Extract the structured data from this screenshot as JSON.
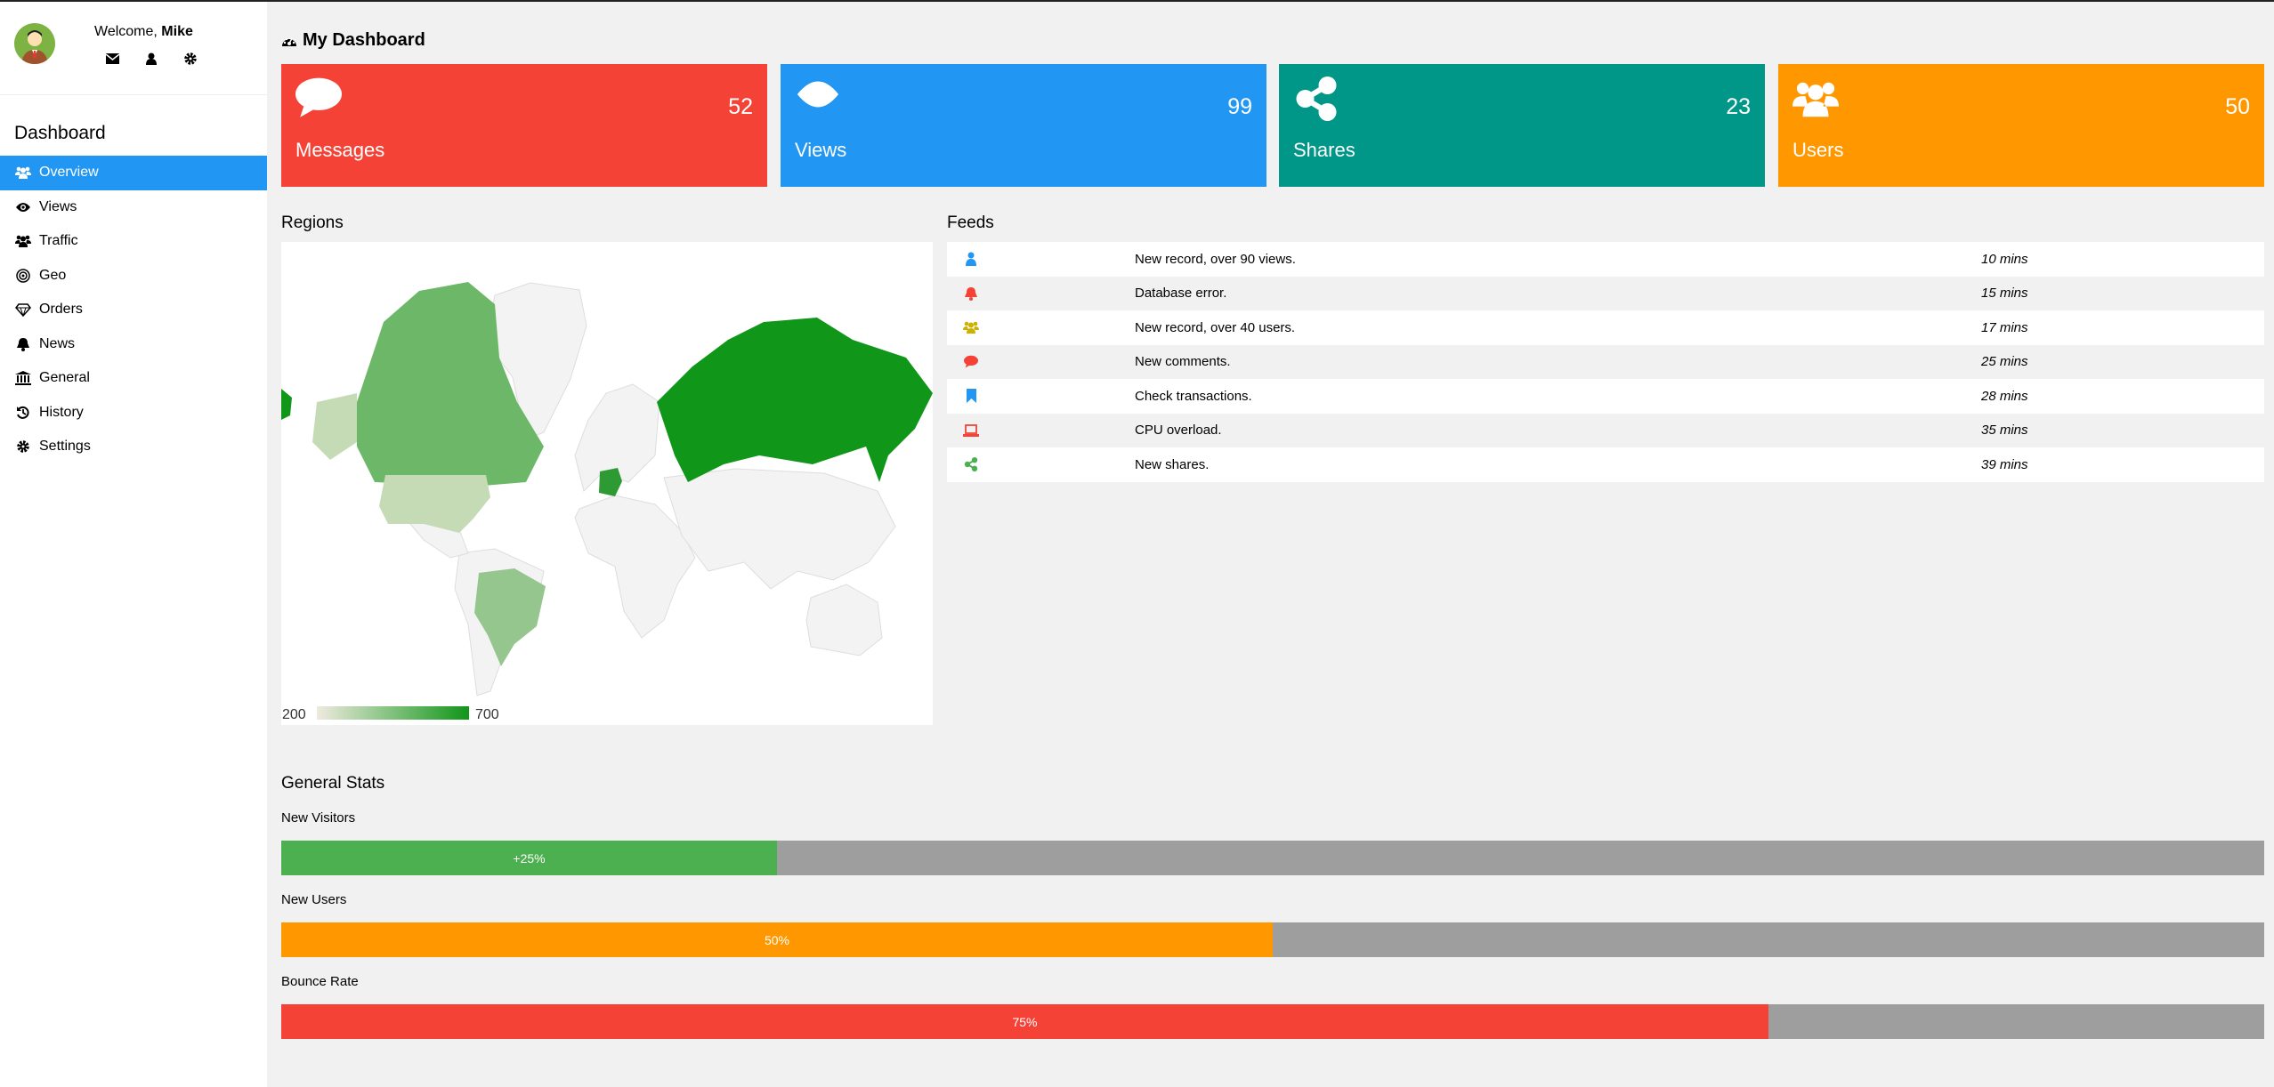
{
  "user": {
    "welcome": "Welcome,",
    "name": "Mike"
  },
  "header": {
    "title": "My Dashboard"
  },
  "sidebar": {
    "title": "Dashboard",
    "items": [
      {
        "label": "Overview",
        "icon": "users-icon",
        "active": true
      },
      {
        "label": "Views",
        "icon": "eye-icon"
      },
      {
        "label": "Traffic",
        "icon": "users-icon"
      },
      {
        "label": "Geo",
        "icon": "bullseye-icon"
      },
      {
        "label": "Orders",
        "icon": "diamond-icon"
      },
      {
        "label": "News",
        "icon": "bell-icon"
      },
      {
        "label": "General",
        "icon": "bank-icon"
      },
      {
        "label": "History",
        "icon": "history-icon"
      },
      {
        "label": "Settings",
        "icon": "cog-icon"
      }
    ]
  },
  "cards": [
    {
      "label": "Messages",
      "value": "52",
      "color": "#f44336",
      "icon": "comment-icon"
    },
    {
      "label": "Views",
      "value": "99",
      "color": "#2196f3",
      "icon": "eye-icon"
    },
    {
      "label": "Shares",
      "value": "23",
      "color": "#009688",
      "icon": "share-icon"
    },
    {
      "label": "Users",
      "value": "50",
      "color": "#ff9800",
      "icon": "users-icon"
    }
  ],
  "regions": {
    "title": "Regions",
    "legend_min": "200",
    "legend_max": "700"
  },
  "feeds": {
    "title": "Feeds",
    "items": [
      {
        "text": "New record, over 90 views.",
        "time": "10 mins",
        "icon": "user-icon",
        "color": "#2196f3"
      },
      {
        "text": "Database error.",
        "time": "15 mins",
        "icon": "bell-icon",
        "color": "#f44336"
      },
      {
        "text": "New record, over 40 users.",
        "time": "17 mins",
        "icon": "users-icon",
        "color": "#cdb100"
      },
      {
        "text": "New comments.",
        "time": "25 mins",
        "icon": "comment-icon",
        "color": "#f44336"
      },
      {
        "text": "Check transactions.",
        "time": "28 mins",
        "icon": "bookmark-icon",
        "color": "#2196f3"
      },
      {
        "text": "CPU overload.",
        "time": "35 mins",
        "icon": "laptop-icon",
        "color": "#f44336"
      },
      {
        "text": "New shares.",
        "time": "39 mins",
        "icon": "share-icon",
        "color": "#4caf50"
      }
    ]
  },
  "stats": {
    "title": "General Stats",
    "items": [
      {
        "label": "New Visitors",
        "value": "+25%",
        "percent": 25,
        "color": "#4caf50"
      },
      {
        "label": "New Users",
        "value": "50%",
        "percent": 50,
        "color": "#ff9800"
      },
      {
        "label": "Bounce Rate",
        "value": "75%",
        "percent": 75,
        "color": "#f44336"
      }
    ]
  }
}
